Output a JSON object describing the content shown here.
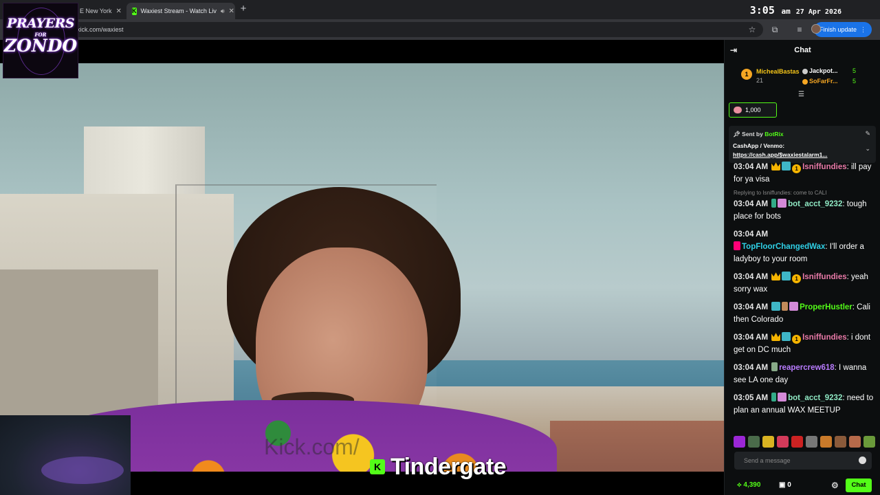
{
  "browser": {
    "tab1_title": "E New York",
    "tab2_title": "Waxiest Stream - Watch Liv",
    "url": "kick.com/waxiest",
    "finish_update": "Finish update",
    "time": "3:05",
    "ampm": "am",
    "date": "27 Apr 2026"
  },
  "logo": {
    "line1": "PRAYERS",
    "line2": "FOR",
    "line3": "ZONDO"
  },
  "video": {
    "watermark": "Kick.com/",
    "overlay_title": "Tindergate",
    "kick_letter": "K"
  },
  "chat": {
    "title": "Chat",
    "leaderboard": [
      {
        "rank": "1",
        "name": "MichealBastas",
        "count": "21"
      },
      {
        "name": "Jackpot...",
        "count": "5"
      },
      {
        "name": "SoFarFr...",
        "count": "5"
      }
    ],
    "gift_count": "1,000",
    "pinned": {
      "sent_by_label": "Sent by",
      "sender": "BotRix",
      "line1": "CashApp / Venmo:",
      "line2": "https://cash.app/$waxiestalarm1..."
    },
    "messages": [
      {
        "ts": "03:04 AM",
        "user": "Isniffundies",
        "color": "#e97aa8",
        "text": "ill pay for ya visa"
      },
      {
        "reply": "Replying to Isniffundies: come to CALI",
        "ts": "03:04 AM",
        "user": "bot_acct_9232",
        "color": "#8fe8c3",
        "text": "tough place for bots"
      },
      {
        "ts": "03:04 AM",
        "user": "TopFloorChangedWax",
        "color": "#2fd0e6",
        "text": "I'll order a ladyboy to your room"
      },
      {
        "ts": "03:04 AM",
        "user": "Isniffundies",
        "color": "#e97aa8",
        "text": "yeah sorry wax"
      },
      {
        "ts": "03:04 AM",
        "user": "ProperHustler",
        "color": "#53fc18",
        "text": "Cali then Colorado"
      },
      {
        "ts": "03:04 AM",
        "user": "Isniffundies",
        "color": "#e97aa8",
        "text": "i dont get on DC much"
      },
      {
        "ts": "03:04 AM",
        "user": "reapercrew618",
        "color": "#b97cff",
        "text": "I wanna see LA one day"
      },
      {
        "ts": "03:05 AM",
        "user": "bot_acct_9232",
        "color": "#8fe8c3",
        "text": "need to plan an annual WAX MEETUP"
      }
    ],
    "input_placeholder": "Send a message",
    "points": "4,390",
    "kicks": "0",
    "chat_button": "Chat"
  },
  "colors": {
    "kick_green": "#53fc18",
    "chat_bg": "#0c0e0f"
  }
}
